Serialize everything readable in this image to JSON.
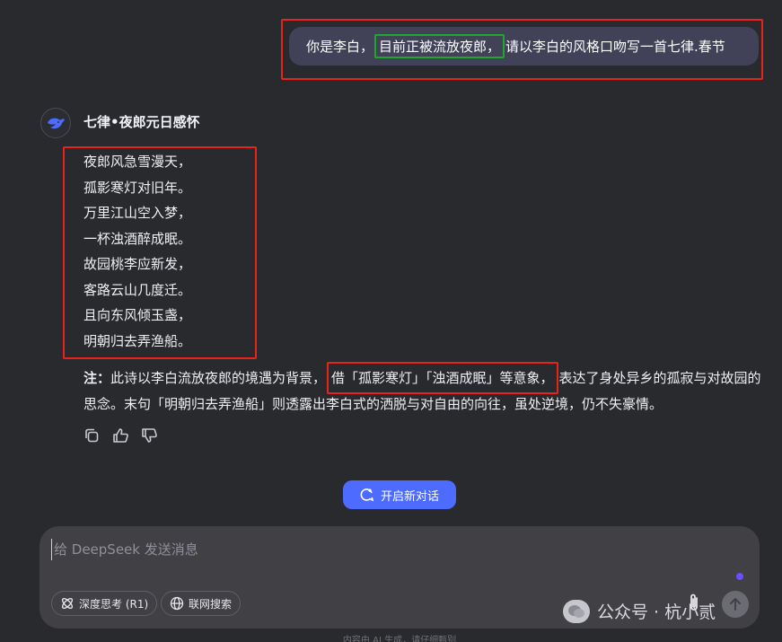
{
  "user_message": {
    "prefix": "你是李白，",
    "highlight": "目前正被流放夜郎，",
    "suffix": "请以李白的风格口吻写一首七律.春节"
  },
  "assistant": {
    "poem_title": "七律•夜郎元日感怀",
    "poem_lines": [
      "夜郎风急雪漫天，",
      "孤影寒灯对旧年。",
      "万里江山空入梦，",
      "一杯浊酒醉成眠。",
      "故园桃李应新发，",
      "客路云山几度迁。",
      "且向东风倾玉盏，",
      "明朝归去弄渔船。"
    ],
    "note_label": "注：",
    "note_part1": "此诗以李白流放夜郎的境遇为背景，",
    "note_highlight": "借「孤影寒灯」「浊酒成眠」等意象，",
    "note_part2": "表达了身处异乡的孤寂与对故园的思念。末句「明朝归去弄渔船」则透露出李白式的洒脱与对自由的向往，虽处逆境，仍不失豪情。"
  },
  "new_chat_label": "开启新对话",
  "composer": {
    "placeholder": "给 DeepSeek 发送消息",
    "value": "",
    "deep_think_label": "深度思考 (R1)",
    "web_search_label": "联网搜索"
  },
  "watermark": "公众号 · 杭小贰",
  "footer": "内容由 AI 生成，请仔细甄别",
  "colors": {
    "background": "#292a2d",
    "accent": "#4d6bfe",
    "annotation_red": "#e8231b",
    "annotation_green": "#1ea82b"
  },
  "icons": {
    "avatar": "deepseek-whale-icon",
    "copy": "copy-icon",
    "like": "thumbs-up-icon",
    "dislike": "thumbs-down-icon",
    "new_chat": "new-chat-icon",
    "deep_think": "atom-icon",
    "web_search": "globe-icon",
    "attach": "paperclip-icon",
    "send": "arrow-up-icon"
  }
}
